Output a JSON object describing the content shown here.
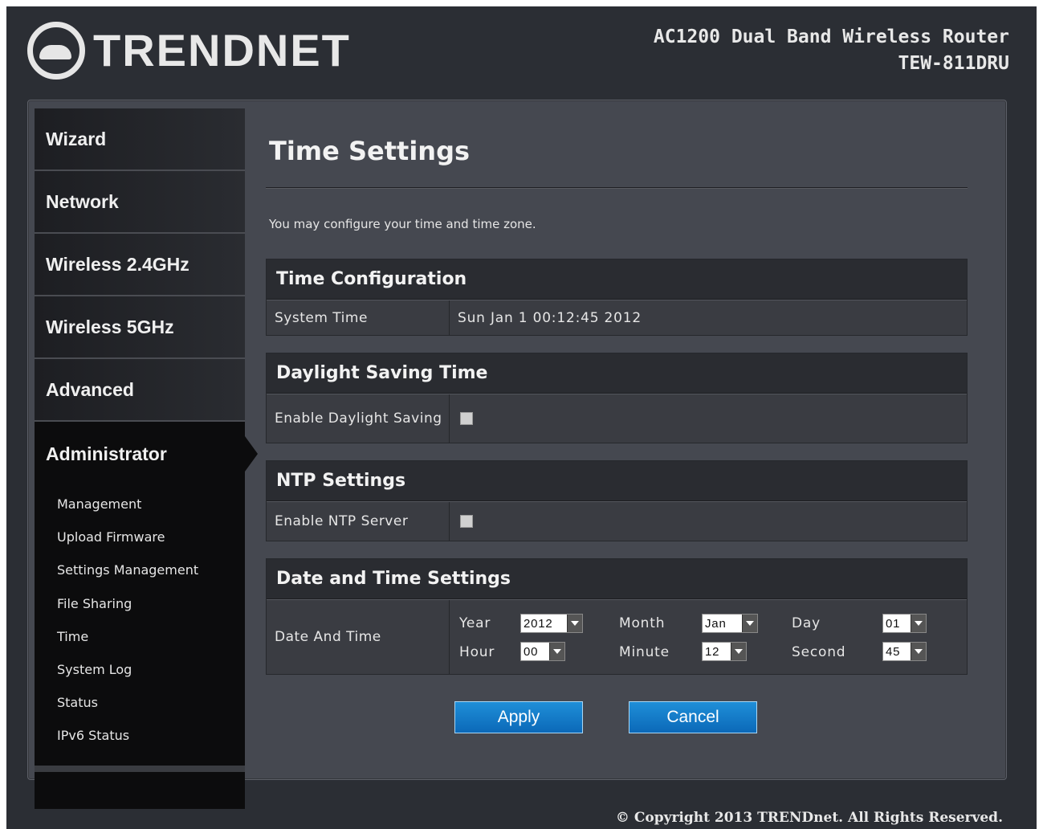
{
  "header": {
    "brand": "TRENDNET",
    "product_line1": "AC1200 Dual Band Wireless Router",
    "product_line2": "TEW-811DRU"
  },
  "sidebar": {
    "items": [
      {
        "label": "Wizard"
      },
      {
        "label": "Network"
      },
      {
        "label": "Wireless 2.4GHz"
      },
      {
        "label": "Wireless 5GHz"
      },
      {
        "label": "Advanced"
      },
      {
        "label": "Administrator"
      }
    ],
    "sub_items": [
      {
        "label": "Management"
      },
      {
        "label": "Upload Firmware"
      },
      {
        "label": "Settings Management"
      },
      {
        "label": "File Sharing"
      },
      {
        "label": "Time"
      },
      {
        "label": "System Log"
      },
      {
        "label": "Status"
      },
      {
        "label": "IPv6 Status"
      }
    ]
  },
  "main": {
    "title": "Time Settings",
    "intro": "You may configure your time and time zone.",
    "time_config": {
      "heading": "Time Configuration",
      "system_time_label": "System Time",
      "system_time_value": "Sun Jan 1 00:12:45 2012"
    },
    "dst": {
      "heading": "Daylight Saving Time",
      "enable_label": "Enable Daylight Saving",
      "enabled": false
    },
    "ntp": {
      "heading": "NTP Settings",
      "enable_label": "Enable NTP Server",
      "enabled": false
    },
    "datetime": {
      "heading": "Date and Time Settings",
      "row_label": "Date And Time",
      "year_label": "Year",
      "year_value": "2012",
      "month_label": "Month",
      "month_value": "Jan",
      "day_label": "Day",
      "day_value": "01",
      "hour_label": "Hour",
      "hour_value": "00",
      "minute_label": "Minute",
      "minute_value": "12",
      "second_label": "Second",
      "second_value": "45"
    },
    "buttons": {
      "apply": "Apply",
      "cancel": "Cancel"
    }
  },
  "footer": {
    "copyright": "© Copyright 2013 TRENDnet. All Rights Reserved."
  }
}
